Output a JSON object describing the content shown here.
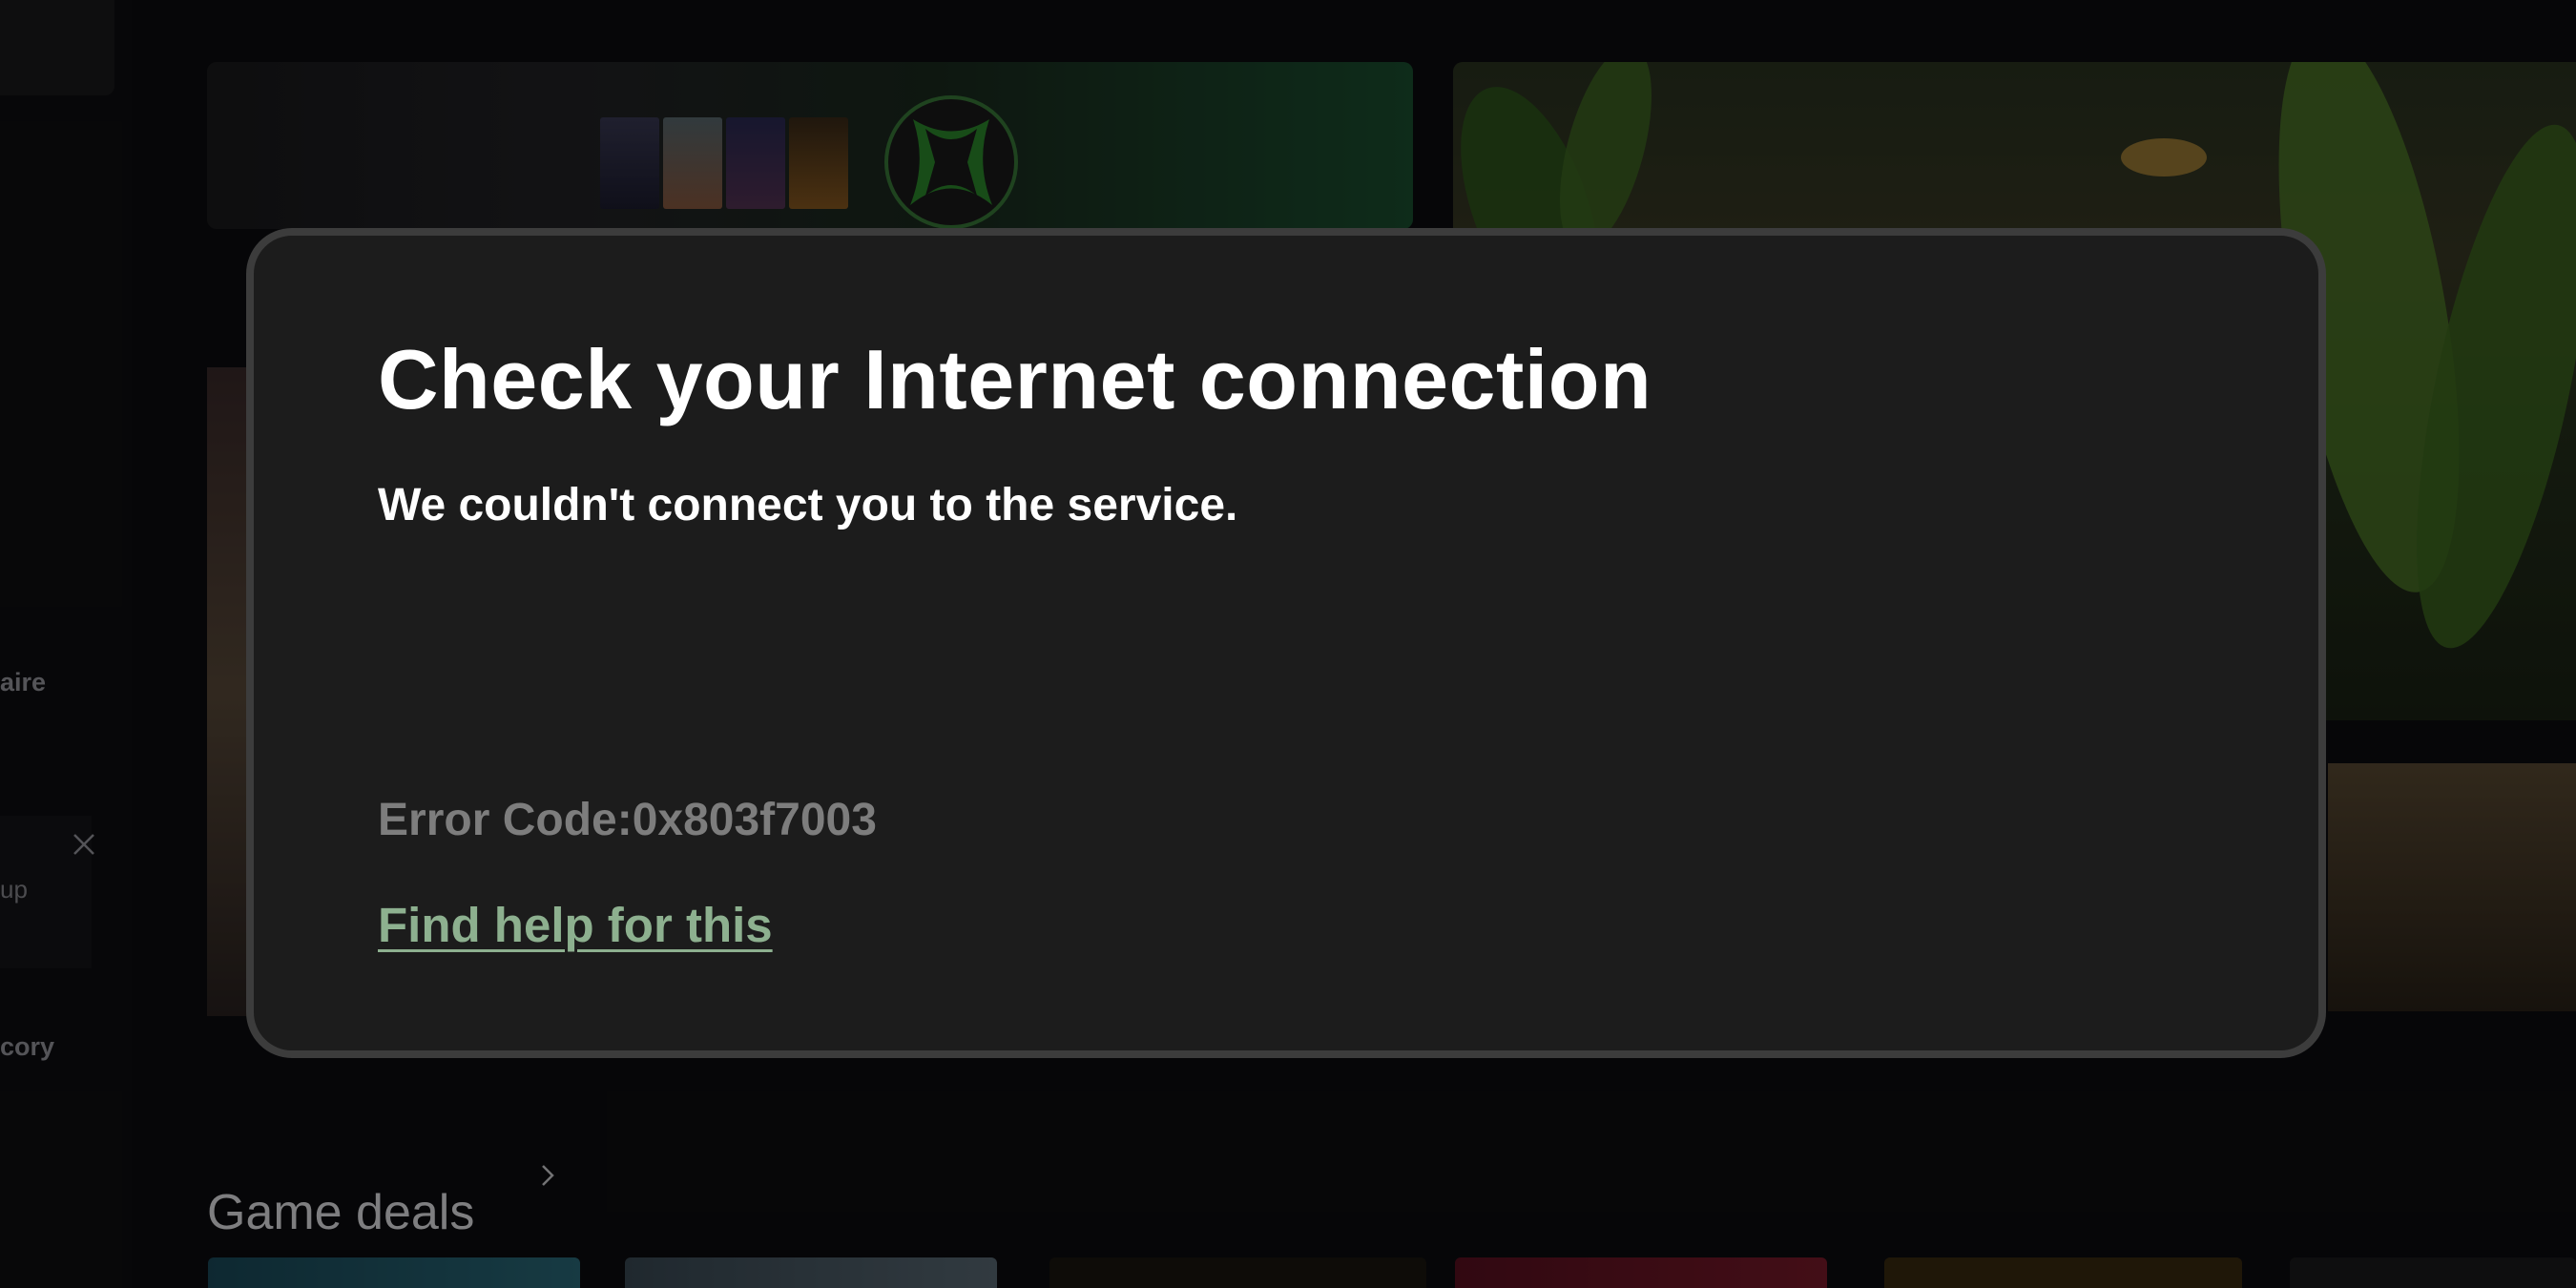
{
  "sidebar": {
    "items": [
      {
        "label": "aire"
      },
      {
        "label": "cory"
      }
    ],
    "notification": {
      "text": "up",
      "close_icon": "close-icon"
    }
  },
  "main": {
    "section_title": "Game deals",
    "section_chevron_icon": "chevron-right-icon"
  },
  "dialog": {
    "title": "Check your Internet connection",
    "message": "We couldn't connect you to the service.",
    "error_code": "Error Code:0x803f7003",
    "help_link": "Find help for this"
  },
  "colors": {
    "dialog_background": "#1c1c1c",
    "dialog_border": "#3c3c3c",
    "error_text": "#7d7d7d",
    "help_link": "#8db08f",
    "xbox_green": "#107c10"
  }
}
